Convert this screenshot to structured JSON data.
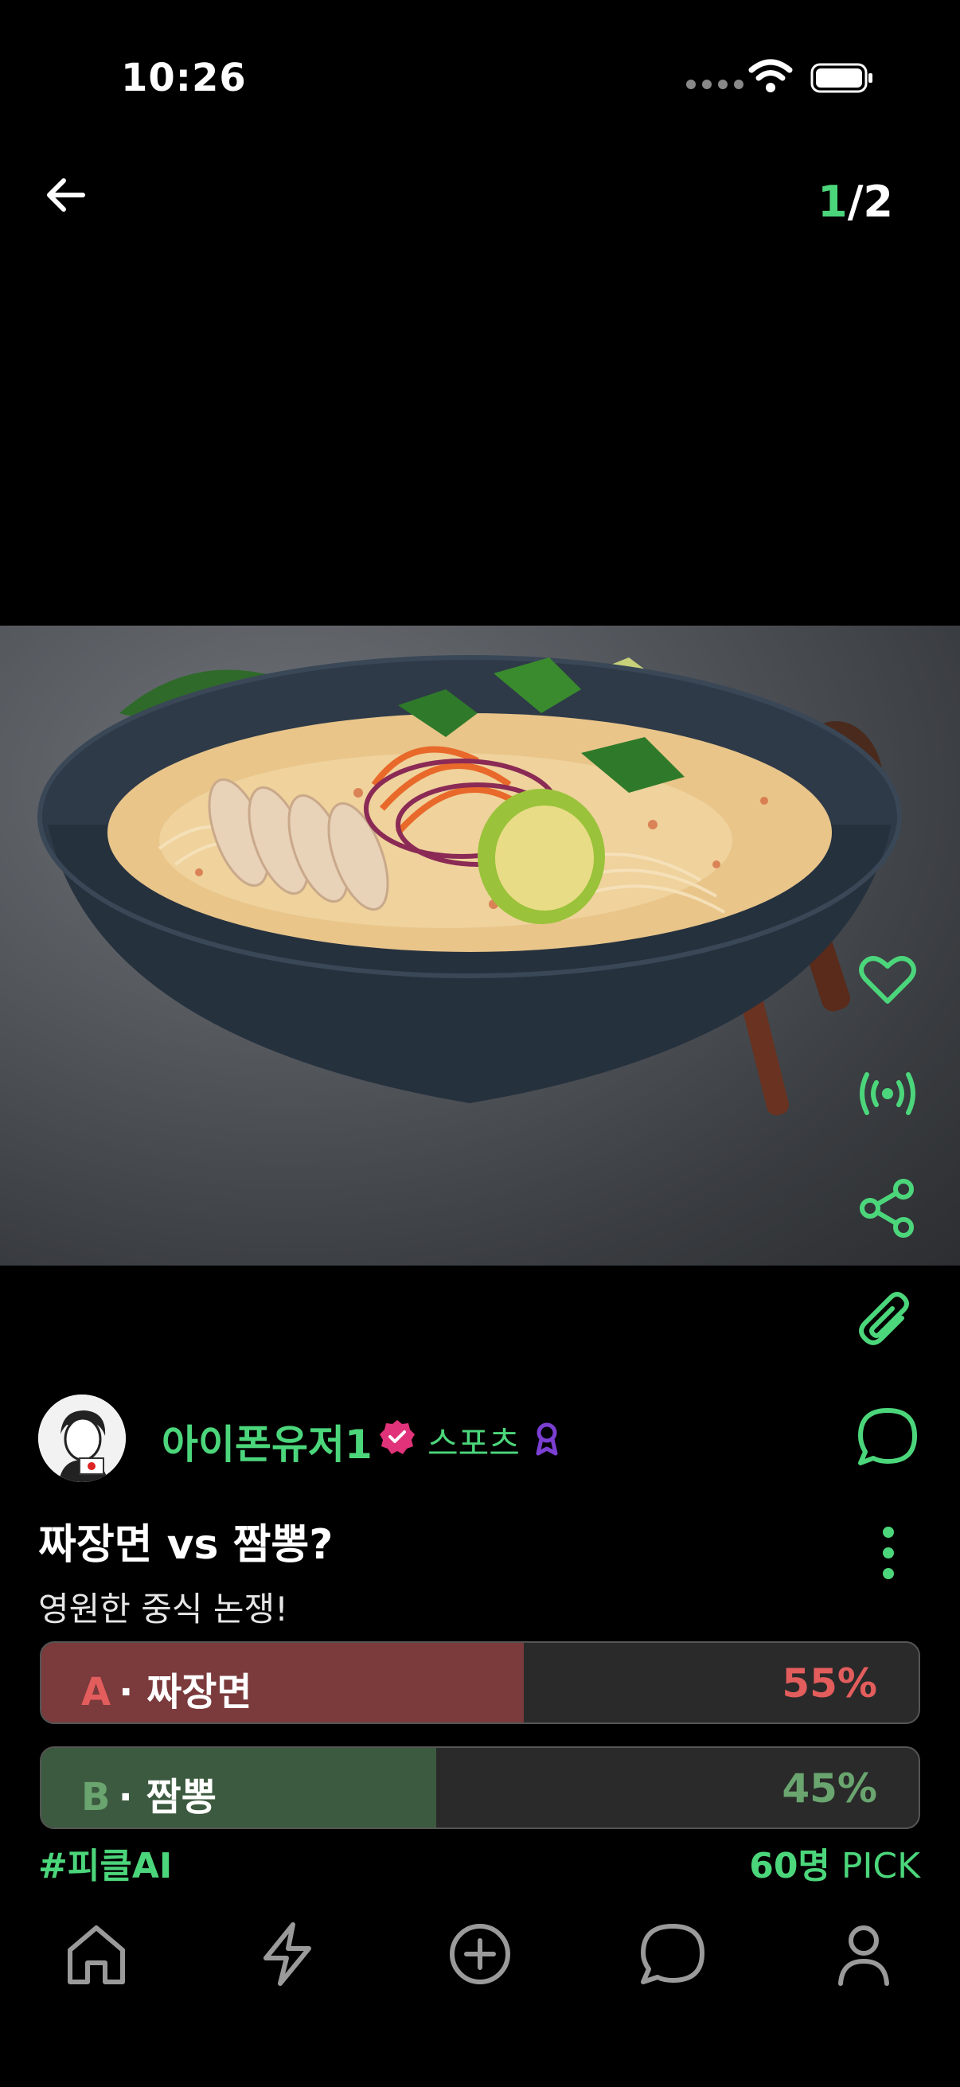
{
  "status_bar": {
    "time": "10:26"
  },
  "header": {
    "page_current": "1",
    "page_total": "/2"
  },
  "post": {
    "username": "아이폰유저1",
    "category": "스포츠",
    "title": "짜장면 vs 짬뽕?",
    "subtitle": "영원한 중식 논쟁!",
    "options": [
      {
        "letter": "A",
        "label": "· 짜장면",
        "percent_text": "55%",
        "percent": 55,
        "color": "#7b3a3c"
      },
      {
        "letter": "B",
        "label": "· 짬뽕",
        "percent_text": "45%",
        "percent": 45,
        "color": "#3c5a3f"
      }
    ],
    "hashtag": "#피클AI",
    "pick_count": "60명",
    "pick_label": " PICK"
  },
  "side_actions": [
    "heart-icon",
    "broadcast-icon",
    "share-icon",
    "paperclip-icon",
    "comment-icon"
  ],
  "tab_bar": [
    "home-icon",
    "lightning-icon",
    "add-circle-icon",
    "chat-icon",
    "profile-icon"
  ],
  "colors": {
    "accent": "#4CD67B",
    "option_a": "#e35d5d",
    "option_b": "#6aa56f",
    "verified": "#e0337a",
    "ribbon": "#7b3fd1"
  }
}
